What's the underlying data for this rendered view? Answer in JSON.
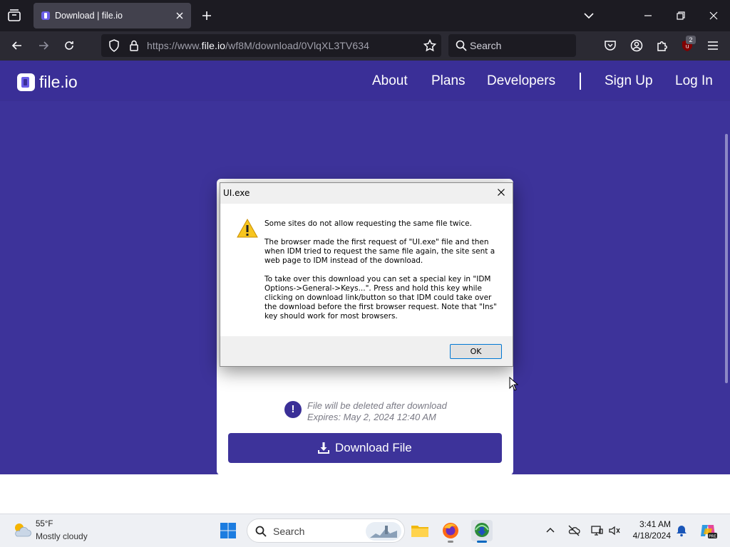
{
  "browser": {
    "tab": {
      "title": "Download | file.io"
    },
    "url": {
      "prefix": "https://www.",
      "host": "file.io",
      "path": "/wf8M/download/0VlqXL3TV634"
    },
    "search_placeholder": "Search",
    "extension_badge": "2"
  },
  "site": {
    "logo": "file.io",
    "nav": {
      "about": "About",
      "plans": "Plans",
      "developers": "Developers",
      "signup": "Sign Up",
      "login": "Log In"
    }
  },
  "card": {
    "delete_notice": "File will be deleted after download",
    "expires": "Expires: May 2, 2024 12:40 AM",
    "download_label": "Download File"
  },
  "dialog": {
    "title": "UI.exe",
    "para1": "Some sites do not allow requesting the same file twice.",
    "para2": "The browser made the first request of \"UI.exe\" file and then\nwhen IDM tried to request the same file again, the site sent a\nweb page to IDM instead of the download.",
    "para3": "To take over this download you can set a special key in \"IDM\nOptions->General->Keys...\". Press and hold this key while\nclicking on download link/button so that IDM could take over\nthe download before the first browser request. Note that \"Ins\"\nkey should work for most browsers.",
    "ok_label": "OK"
  },
  "taskbar": {
    "weather": {
      "temp": "55°F",
      "desc": "Mostly cloudy"
    },
    "search_placeholder": "Search",
    "clock": {
      "time": "3:41 AM",
      "date": "4/18/2024"
    }
  },
  "icons": {
    "tab_list": "tab-list-icon",
    "close": "close-icon",
    "new_tab": "plus-icon",
    "back": "arrow-left-icon",
    "forward": "arrow-right-icon",
    "reload": "reload-icon",
    "shield": "shield-icon",
    "lock": "lock-icon",
    "star": "star-icon",
    "search": "search-icon",
    "pocket": "pocket-icon",
    "account": "account-icon",
    "extensions": "puzzle-icon",
    "ublock": "ublock-icon",
    "menu": "hamburger-icon",
    "warning": "warning-icon",
    "download": "download-icon",
    "info": "exclamation-icon"
  },
  "colors": {
    "brand_purple": "#3d339a",
    "browser_chrome": "#2b2a33",
    "dialog_ok_border": "#0078d4"
  }
}
